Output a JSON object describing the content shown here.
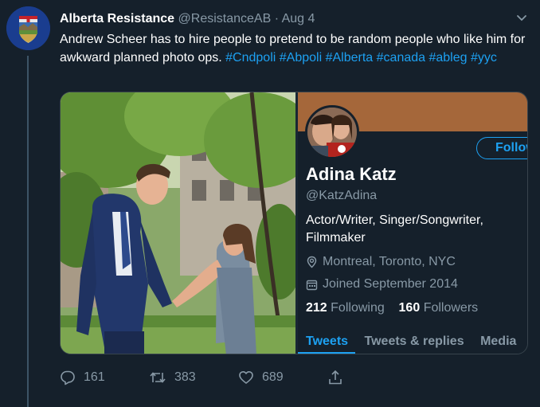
{
  "tweet": {
    "author_name": "Alberta Resistance",
    "author_handle": "@ResistanceAB",
    "separator": "·",
    "date": "Aug 4",
    "text_plain": "Andrew Scheer has to hire people to pretend to be random people who like him for awkward planned photo ops.",
    "hashtags": [
      "#Cndpoli",
      "#Abpoli",
      "#Alberta",
      "#canada",
      "#ableg",
      "#yyc"
    ]
  },
  "profile_card": {
    "name": "Adina Katz",
    "handle": "@KatzAdina",
    "follow_label": "Follow",
    "bio": "Actor/Writer, Singer/Songwriter, Filmmaker",
    "location": "Montreal, Toronto, NYC",
    "joined": "Joined September 2014",
    "following_count": "212",
    "following_label": "Following",
    "followers_count": "160",
    "followers_label": "Followers",
    "tabs": [
      "Tweets",
      "Tweets & replies",
      "Media"
    ],
    "active_tab": "Tweets"
  },
  "actions": {
    "replies": "161",
    "retweets": "383",
    "likes": "689"
  },
  "icons": {
    "reply": "reply-icon",
    "retweet": "retweet-icon",
    "like": "heart-icon",
    "share": "share-icon",
    "caret": "chevron-down-icon",
    "location": "location-pin-icon",
    "calendar": "calendar-icon"
  },
  "colors": {
    "background": "#15202b",
    "accent": "#1da1f2",
    "muted": "#8899a6",
    "banner": "#a5673a"
  }
}
